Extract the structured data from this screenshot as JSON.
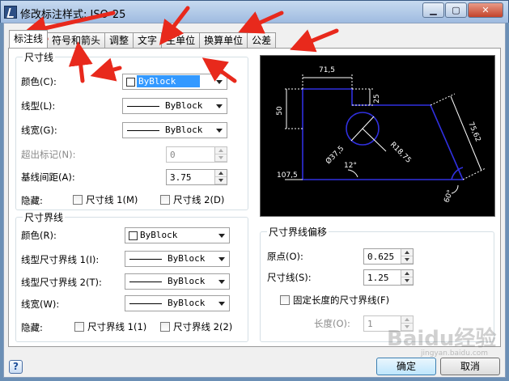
{
  "window": {
    "title": "修改标注样式: ISO-25",
    "min": "0",
    "max": "1",
    "close": "r"
  },
  "tabs": [
    {
      "label": "标注线",
      "active": true
    },
    {
      "label": "符号和箭头"
    },
    {
      "label": "调整"
    },
    {
      "label": "文字"
    },
    {
      "label": "主单位"
    },
    {
      "label": "换算单位"
    },
    {
      "label": "公差"
    }
  ],
  "dim_line": {
    "title": "尺寸线",
    "color_label": "颜色(C):",
    "color_value": "ByBlock",
    "linetype_label": "线型(L):",
    "linetype_value": "ByBlock",
    "lineweight_label": "线宽(G):",
    "lineweight_value": "ByBlock",
    "extend_label": "超出标记(N):",
    "extend_value": "0",
    "baseline_label": "基线间距(A):",
    "baseline_value": "3.75",
    "suppress_label": "隐藏:",
    "suppress_1": "尺寸线 1(M)",
    "suppress_2": "尺寸线 2(D)"
  },
  "ext_line": {
    "title": "尺寸界线",
    "color_label": "颜色(R):",
    "color_value": "ByBlock",
    "linetype1_label": "线型尺寸界线 1(I):",
    "linetype1_value": "ByBlock",
    "linetype2_label": "线型尺寸界线 2(T):",
    "linetype2_value": "ByBlock",
    "lineweight_label": "线宽(W):",
    "lineweight_value": "ByBlock",
    "suppress_label": "隐藏:",
    "suppress_1": "尺寸界线 1(1)",
    "suppress_2": "尺寸界线 2(2)"
  },
  "offset": {
    "title": "尺寸界线偏移",
    "origin_label": "原点(O):",
    "origin_value": "0.625",
    "dimline_label": "尺寸线(S):",
    "dimline_value": "1.25",
    "fixed_label": "固定长度的尺寸界线(F)",
    "length_label": "长度(O):",
    "length_value": "1"
  },
  "preview": {
    "dim_top": "71,5",
    "dim_left": "50",
    "dim_mid": "25",
    "dim_right": "75,62",
    "dim_bottom": "107,5",
    "dim_dia": "Ø37,5",
    "dim_rad": "R18,75",
    "dim_ang1": "12°",
    "dim_ang2": "60°"
  },
  "buttons": {
    "ok": "确定",
    "cancel": "取消",
    "help": "?"
  },
  "watermark": {
    "text": "Baidu经验",
    "sub": "jingyan.baidu.com"
  },
  "colors": {
    "accent_red": "#e8291c",
    "preview_line": "#3030e0",
    "preview_text": "#ffffff"
  }
}
